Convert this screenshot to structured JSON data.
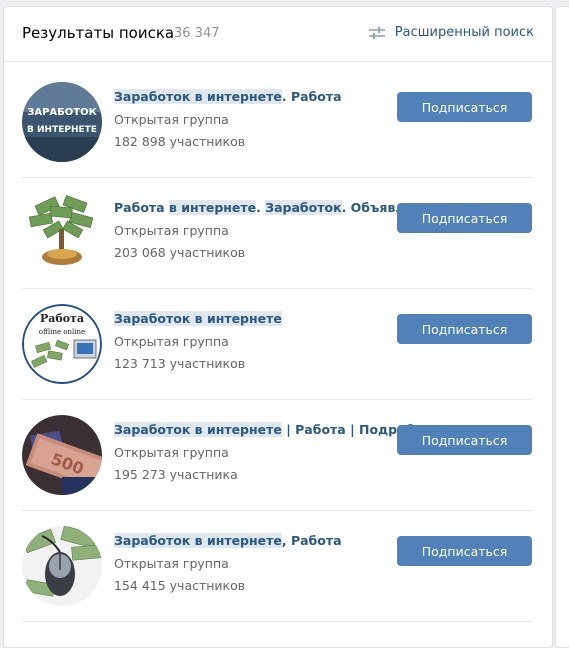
{
  "header": {
    "title": "Результаты поиска",
    "count": "36 347",
    "advanced_search": "Расширенный поиск"
  },
  "groups": [
    {
      "name_parts": [
        {
          "text": "Заработок в интернете",
          "hl": true
        },
        {
          "text": ". Работа",
          "hl": false
        }
      ],
      "type": "Открытая группа",
      "members": "182 898 участников",
      "button": "Подписаться",
      "avatar_text": [
        "ЗАРАБОТОК",
        "В ИНТЕРНЕТЕ"
      ]
    },
    {
      "name_parts": [
        {
          "text": "Работа ",
          "hl": false
        },
        {
          "text": "в интернете",
          "hl": true
        },
        {
          "text": ". ",
          "hl": false
        },
        {
          "text": "Заработок",
          "hl": true
        },
        {
          "text": ". Объявления",
          "hl": false
        }
      ],
      "type": "Открытая группа",
      "members": "203 068 участников",
      "button": "Подписаться",
      "avatar_text": []
    },
    {
      "name_parts": [
        {
          "text": "Заработок в интернете",
          "hl": true
        }
      ],
      "type": "Открытая группа",
      "members": "123 713 участников",
      "button": "Подписаться",
      "avatar_text": [
        "Работа",
        "offline  online"
      ]
    },
    {
      "name_parts": [
        {
          "text": "Заработок в интернете",
          "hl": true
        },
        {
          "text": " | Работа | Подработка",
          "hl": false
        }
      ],
      "type": "Открытая группа",
      "members": "195 273 участника",
      "button": "Подписаться",
      "avatar_text": []
    },
    {
      "name_parts": [
        {
          "text": "Заработок в интернете",
          "hl": true
        },
        {
          "text": ", Работа",
          "hl": false
        }
      ],
      "type": "Открытая группа",
      "members": "154 415 участников",
      "button": "Подписаться",
      "avatar_text": []
    }
  ],
  "colors": {
    "accent": "#5181b8",
    "link": "#2a5885",
    "highlight": "#e1e7ee",
    "muted": "#656565"
  }
}
